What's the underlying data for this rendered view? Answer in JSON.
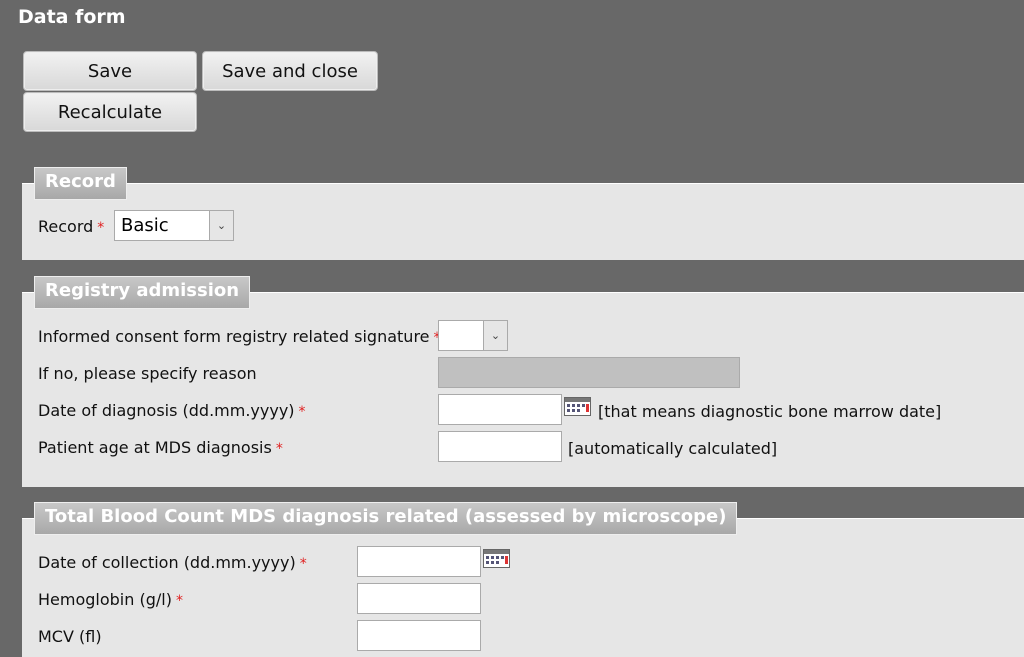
{
  "header": {
    "title": "Data form"
  },
  "toolbar": {
    "save": "Save",
    "save_close": "Save and close",
    "recalculate": "Recalculate"
  },
  "sections": {
    "record": {
      "legend": "Record",
      "label": "Record",
      "required": "*",
      "value": "Basic"
    },
    "registry": {
      "legend": "Registry admission",
      "consent_label": "Informed consent form registry related signature",
      "consent_value": "",
      "reason_label": "If no, please specify reason",
      "diag_date_label": "Date of diagnosis (dd.mm.yyyy)",
      "diag_date_note": "[that means diagnostic bone marrow date]",
      "age_label": "Patient age at MDS diagnosis",
      "age_note": "[automatically calculated]",
      "required": "*"
    },
    "blood": {
      "legend": "Total Blood Count MDS diagnosis related (assessed by microscope)",
      "collection_label": "Date of collection (dd.mm.yyyy)",
      "hemoglobin_label": "Hemoglobin (g/l)",
      "mcv_label": "MCV (fl)",
      "required": "*"
    }
  },
  "icons": {
    "calendar": "calendar-icon",
    "dropdown": "chevron-down-icon"
  }
}
